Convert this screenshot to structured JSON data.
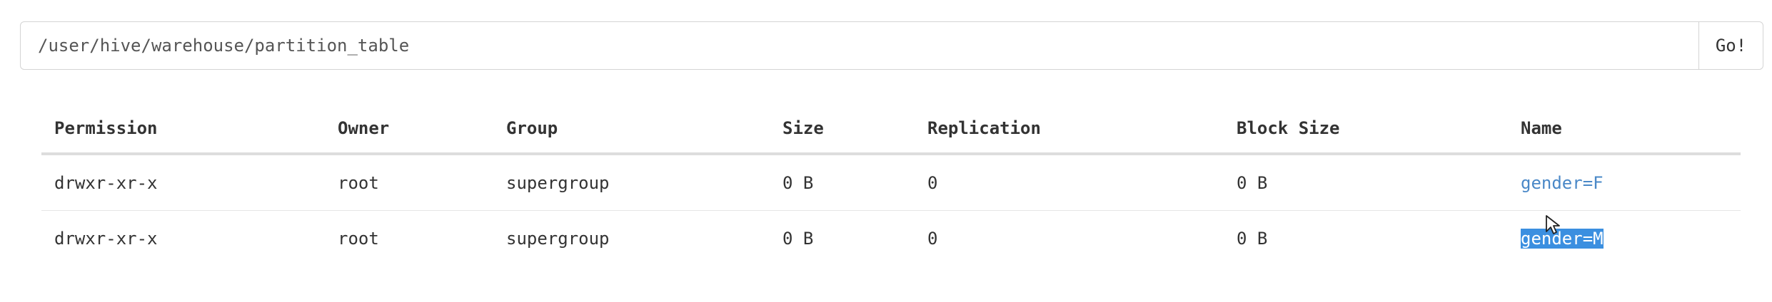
{
  "path_bar": {
    "value": "/user/hive/warehouse/partition_table",
    "go_label": "Go!"
  },
  "table": {
    "headers": [
      "Permission",
      "Owner",
      "Group",
      "Size",
      "Replication",
      "Block Size",
      "Name"
    ],
    "rows": [
      [
        "drwxr-xr-x",
        "root",
        "supergroup",
        "0 B",
        "0",
        "0 B",
        "gender=F"
      ],
      [
        "drwxr-xr-x",
        "root",
        "supergroup",
        "0 B",
        "0",
        "0 B",
        "gender=M"
      ]
    ]
  },
  "colors": {
    "link": "#4a88c7",
    "selection": "#3b8fe0"
  },
  "icons": {
    "cursor": "mouse-pointer-icon"
  }
}
